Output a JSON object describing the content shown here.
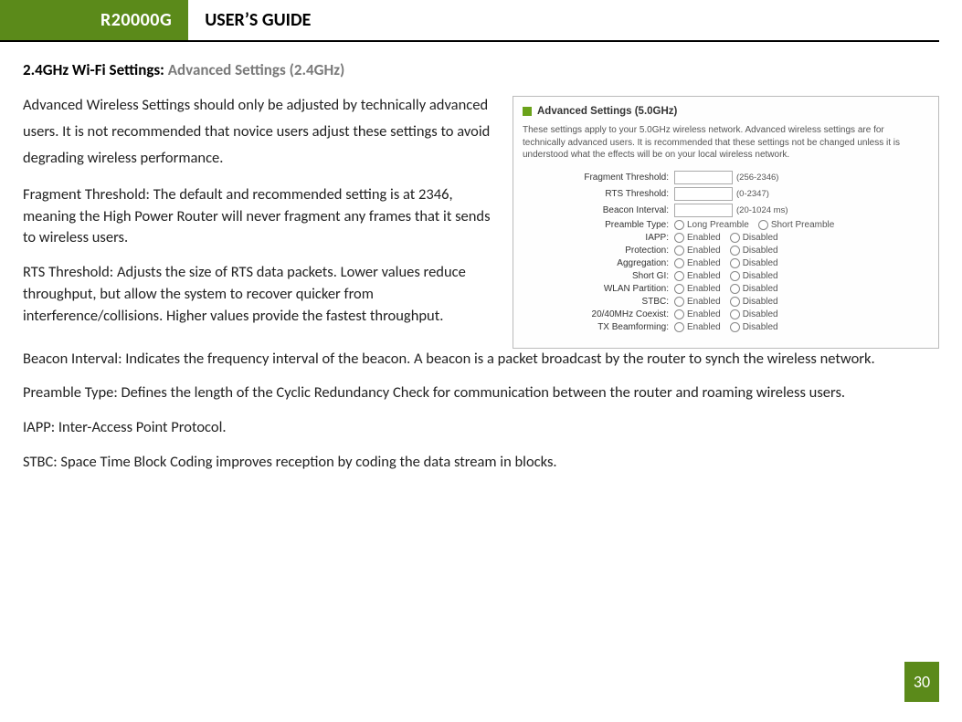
{
  "header": {
    "model": "R20000G",
    "title": "USER’S GUIDE"
  },
  "section": {
    "prefix": "2.4GHz Wi-Fi Settings:",
    "name": "Advanced Settings (2.4GHz)"
  },
  "paragraphs": {
    "intro": "Advanced Wireless Settings should only be adjusted by technically advanced users. It is not recommended that novice users adjust these settings to avoid degrading wireless performance.",
    "frag": "Fragment Threshold: The default and recommended setting is at 2346, meaning the High Power Router will never fragment any frames that it sends to wireless users.",
    "rts": "RTS Threshold: Adjusts the size of RTS data packets. Lower values reduce throughput, but allow the system to recover quicker from interference/collisions. Higher values provide the fastest throughput.",
    "beacon": "Beacon Interval: Indicates the frequency interval of the beacon. A beacon is a packet broadcast by the router to synch the wireless network.",
    "preamble": "Preamble Type: Defines the length of the Cyclic Redundancy Check for communication between the router and roaming wireless users.",
    "iapp": "IAPP: Inter-Access Point Protocol.",
    "stbc": "STBC: Space Time Block Coding improves reception by coding the data stream in blocks."
  },
  "screenshot": {
    "title": "Advanced Settings (5.0GHz)",
    "desc": "These settings apply to your 5.0GHz wireless network. Advanced wireless settings are for technically advanced users. It is recommended that these settings not be changed unless it is understood what the effects will be on your local wireless network.",
    "rows": {
      "frag": {
        "label": "Fragment Threshold:",
        "hint": "(256-2346)"
      },
      "rts": {
        "label": "RTS Threshold:",
        "hint": "(0-2347)"
      },
      "beacon": {
        "label": "Beacon Interval:",
        "hint": "(20-1024 ms)"
      },
      "preamble": {
        "label": "Preamble Type:",
        "o1": "Long Preamble",
        "o2": "Short Preamble"
      },
      "iapp": {
        "label": "IAPP:",
        "o1": "Enabled",
        "o2": "Disabled"
      },
      "protection": {
        "label": "Protection:",
        "o1": "Enabled",
        "o2": "Disabled"
      },
      "aggregation": {
        "label": "Aggregation:",
        "o1": "Enabled",
        "o2": "Disabled"
      },
      "shortgi": {
        "label": "Short GI:",
        "o1": "Enabled",
        "o2": "Disabled"
      },
      "wlanpart": {
        "label": "WLAN Partition:",
        "o1": "Enabled",
        "o2": "Disabled"
      },
      "stbc": {
        "label": "STBC:",
        "o1": "Enabled",
        "o2": "Disabled"
      },
      "coexist": {
        "label": "20/40MHz Coexist:",
        "o1": "Enabled",
        "o2": "Disabled"
      },
      "txbf": {
        "label": "TX Beamforming:",
        "o1": "Enabled",
        "o2": "Disabled"
      }
    }
  },
  "page_number": "30"
}
